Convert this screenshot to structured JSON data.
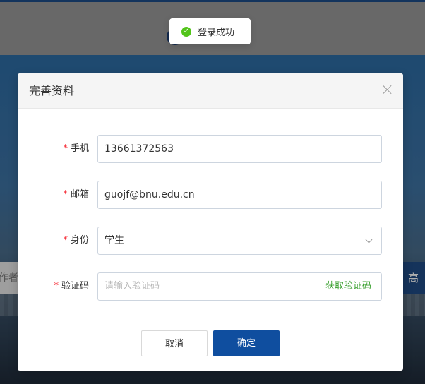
{
  "toast": {
    "icon": "check-circle-icon",
    "text": "登录成功"
  },
  "background": {
    "search_placeholder_fragment": "作者",
    "search_button_fragment": "高"
  },
  "dialog": {
    "title": "完善资料",
    "fields": {
      "phone": {
        "label": "手机",
        "value": "13661372563"
      },
      "email": {
        "label": "邮箱",
        "value": "guojf@bnu.edu.cn"
      },
      "identity": {
        "label": "身份",
        "value": "学生"
      },
      "code": {
        "label": "验证码",
        "placeholder": "请输入验证码",
        "button": "获取验证码"
      }
    },
    "required_mark": "*",
    "cancel_label": "取消",
    "ok_label": "确定"
  },
  "colors": {
    "primary": "#0f4e9f",
    "success": "#52c41a",
    "required": "#f5222d",
    "link_green": "#3aa02f"
  }
}
